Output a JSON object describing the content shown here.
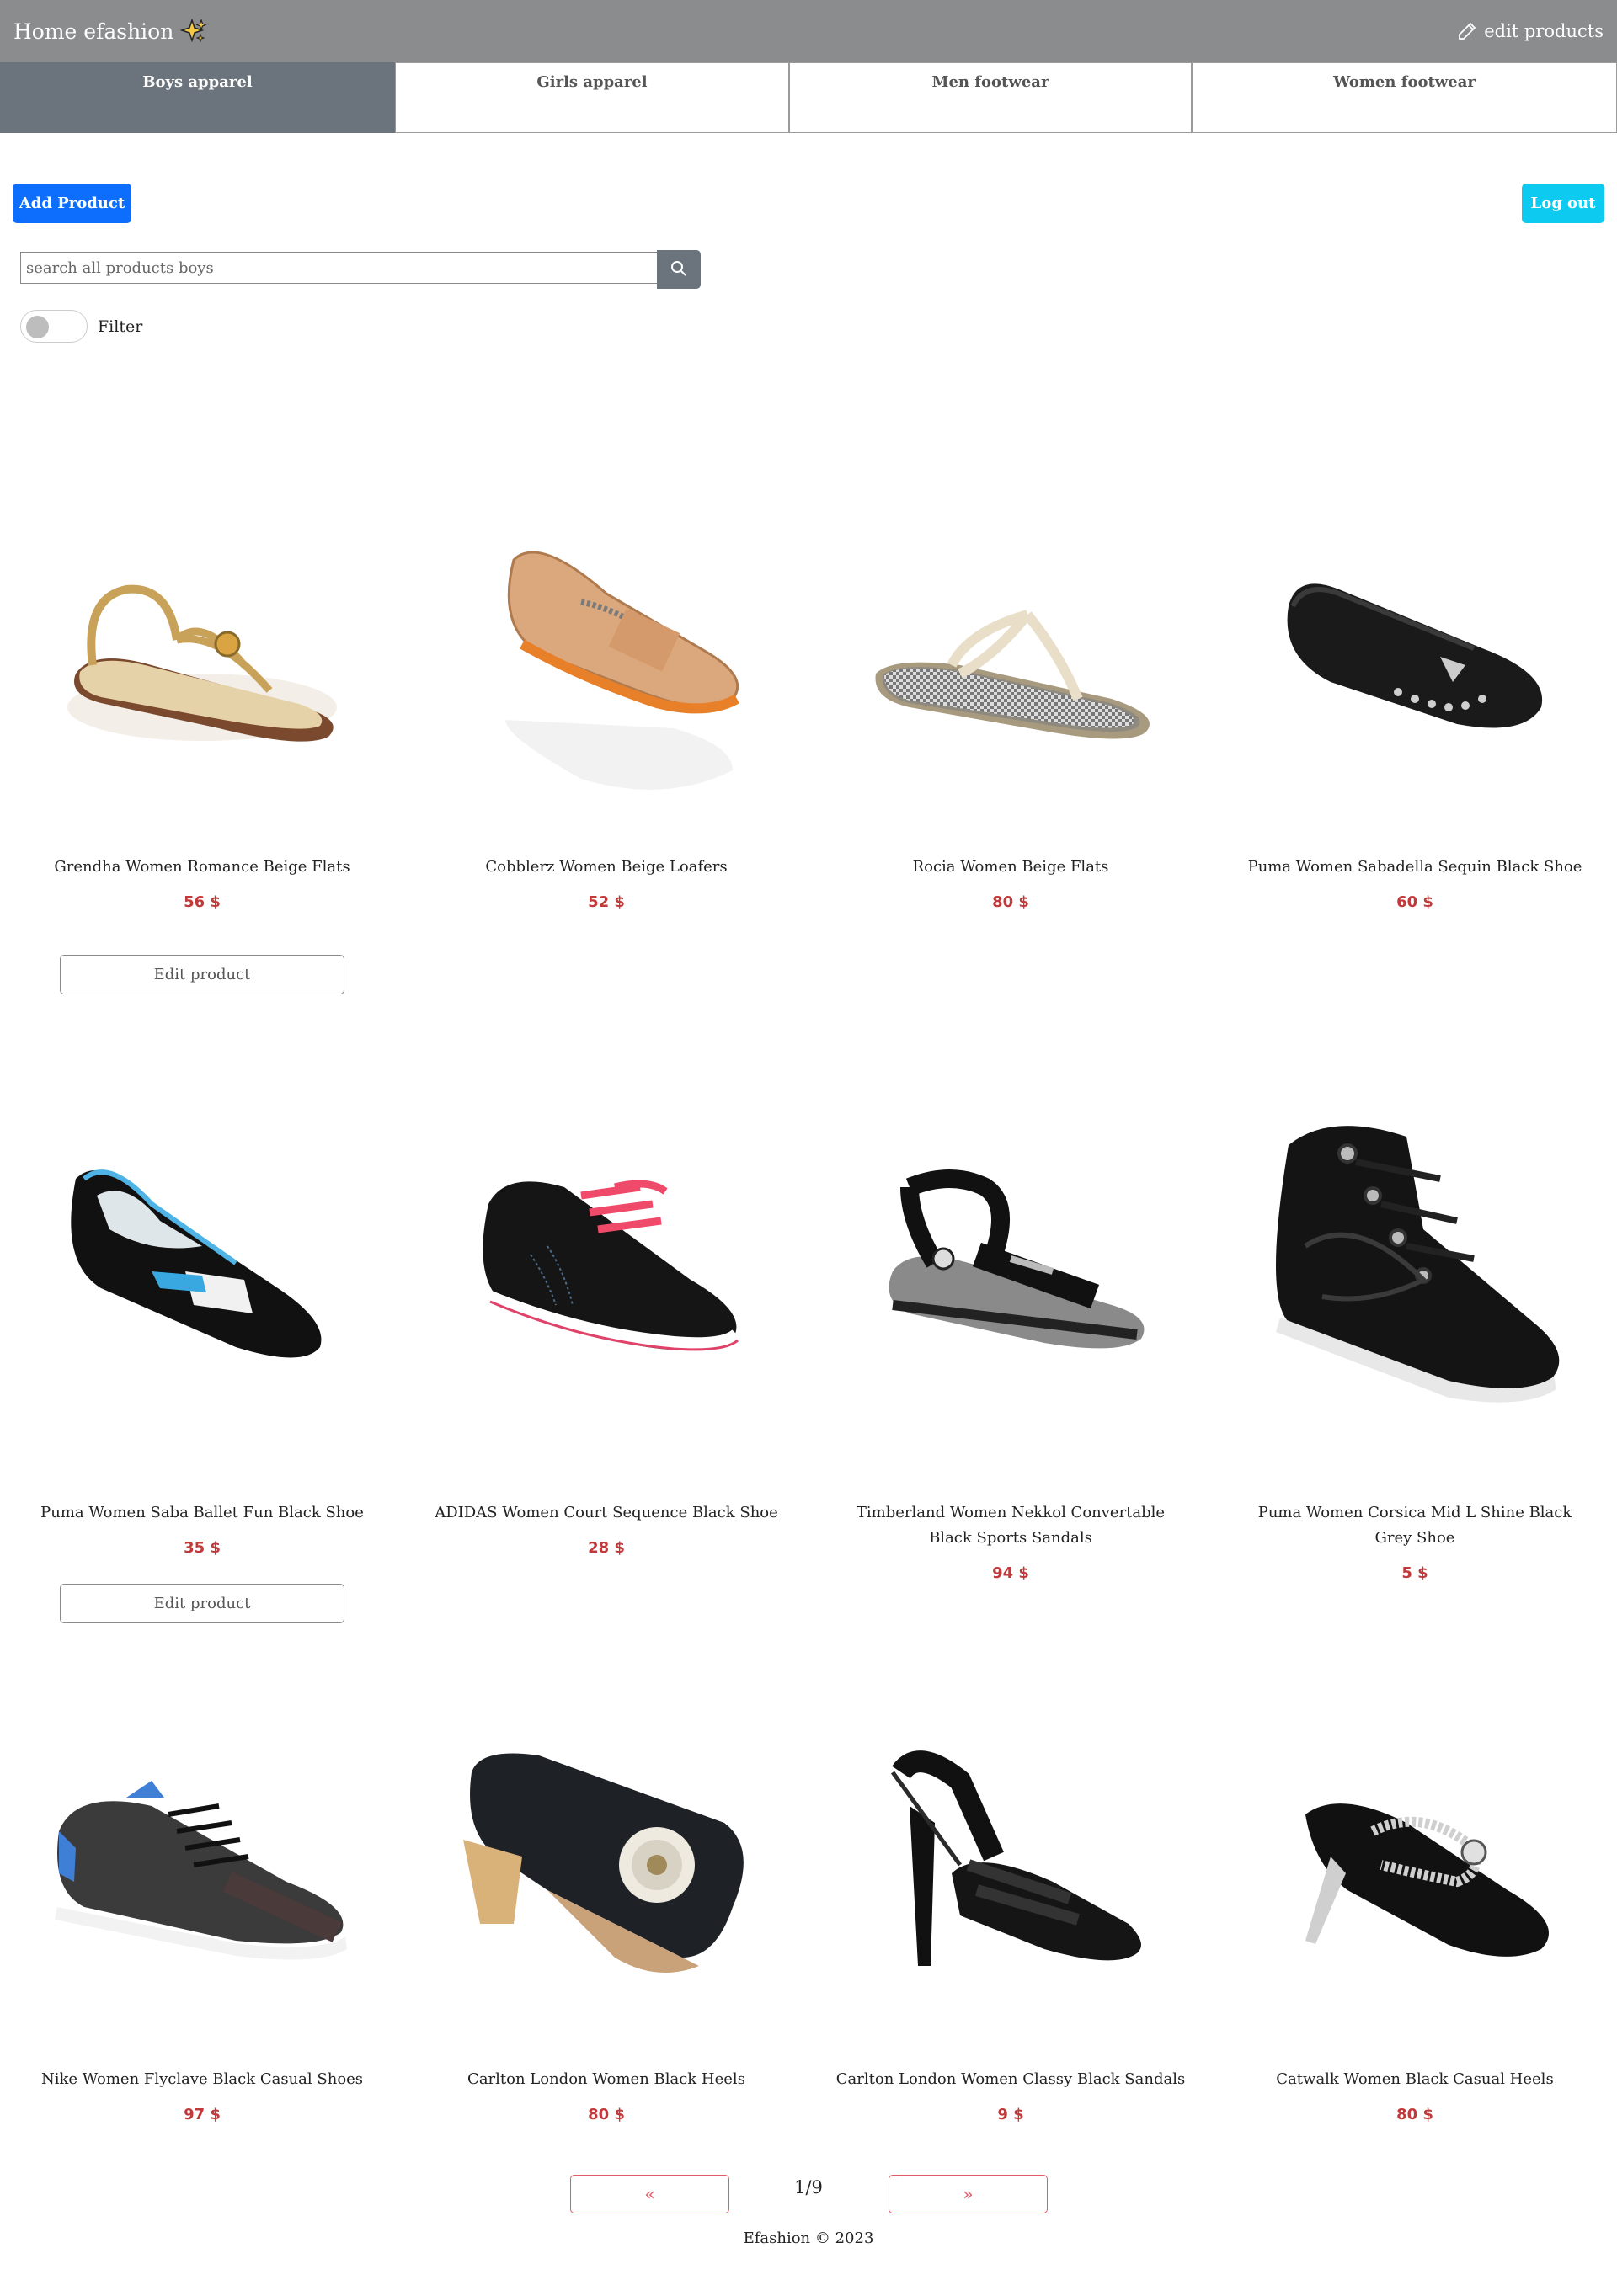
{
  "navbar": {
    "brand": "Home efashion",
    "edit_products": "edit products"
  },
  "tabs": [
    {
      "label": "Boys apparel",
      "active": true
    },
    {
      "label": "Girls apparel",
      "active": false
    },
    {
      "label": "Men footwear",
      "active": false
    },
    {
      "label": "Women footwear",
      "active": false
    }
  ],
  "actions": {
    "add_product": "Add Product",
    "log_out": "Log out"
  },
  "search": {
    "placeholder": "search all products boys"
  },
  "filter": {
    "label": "Filter",
    "enabled": false
  },
  "products": [
    {
      "name": "Grendha Women Romance Beige Flats",
      "price": "56 $",
      "image": "beige-strappy-flat-sandal"
    },
    {
      "name": "Cobblerz Women Beige Loafers",
      "price": "52 $",
      "image": "tan-loafer"
    },
    {
      "name": "Rocia Women Beige Flats",
      "price": "80 $",
      "image": "beige-flip-flop"
    },
    {
      "name": "Puma Women Sabadella Sequin Black Shoe",
      "price": "60 $",
      "image": "black-sequin-ballet-shoe"
    },
    {
      "name": "Puma Women Saba Ballet Fun Black Shoe",
      "price": "35 $",
      "image": "black-blue-ballet-shoe"
    },
    {
      "name": "ADIDAS Women Court Sequence Black Shoe",
      "price": "28 $",
      "image": "black-pink-sneaker"
    },
    {
      "name": "Timberland Women Nekkol Convertable Black Sports Sandals",
      "price": "94 $",
      "image": "black-sports-sandal"
    },
    {
      "name": "Puma Women Corsica Mid L Shine Black Grey Shoe",
      "price": "5 $",
      "image": "black-high-top-sneaker"
    },
    {
      "name": "Nike Women Flyclave Black Casual Shoes",
      "price": "97 $",
      "image": "black-casual-sneaker"
    },
    {
      "name": "Carlton London Women Black Heels",
      "price": "80 $",
      "image": "black-denim-heel"
    },
    {
      "name": "Carlton London Women Classy Black Sandals",
      "price": "9 $",
      "image": "black-heeled-sandal"
    },
    {
      "name": "Catwalk Women Black Casual Heels",
      "price": "80 $",
      "image": "black-jeweled-heel"
    }
  ],
  "edit_product_label": "Edit product",
  "pagination": {
    "prev": "«",
    "next": "»",
    "page": "1/9"
  },
  "footer": "Efashion © 2023",
  "colors": {
    "navbar": "#8a8c8e",
    "active_tab": "#6b747c",
    "primary": "#0d6efd",
    "info": "#0dcaf0",
    "price": "#c0393b",
    "pager": "#e25c68"
  }
}
